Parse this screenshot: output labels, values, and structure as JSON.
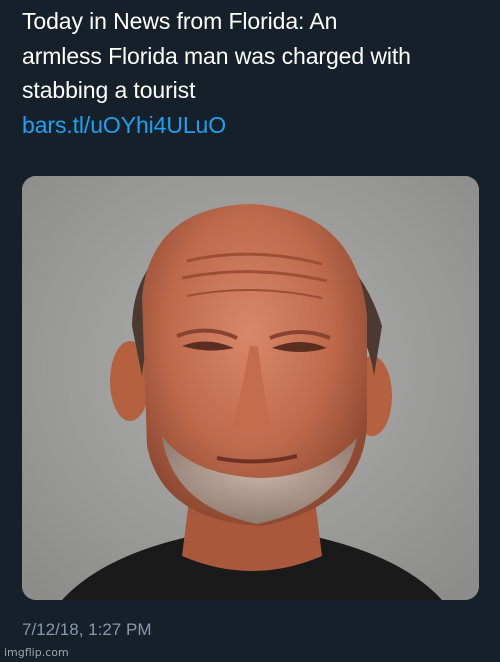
{
  "tweet": {
    "text_lines": [
      "Today in News from Florida: An",
      "armless Florida man was charged with",
      "stabbing a tourist"
    ],
    "link": "bars.tl/uOYhi4ULuO",
    "timestamp": "7/12/18, 1:27 PM"
  },
  "media": {
    "description_icon": "mugshot-photo-icon"
  },
  "watermark": "imgflip.com",
  "colors": {
    "background": "#15202b",
    "text": "#ffffff",
    "link": "#1da1f2",
    "muted": "#8899a6"
  }
}
